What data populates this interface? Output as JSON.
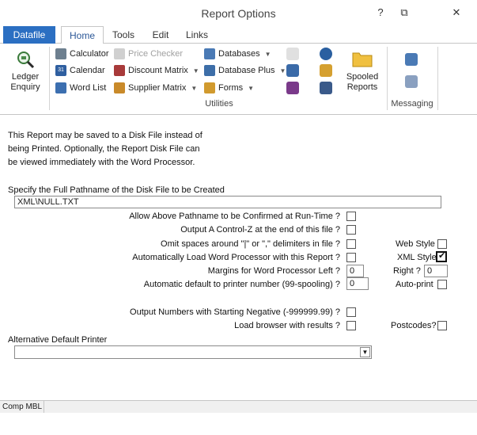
{
  "window": {
    "title": "Report Options"
  },
  "titlebar": {
    "help": "?",
    "restore": "⧉",
    "close": "✕"
  },
  "tabs": {
    "file": "Datafile",
    "home": "Home",
    "tools": "Tools",
    "edit": "Edit",
    "links": "Links"
  },
  "ribbon": {
    "ledger": {
      "line1": "Ledger",
      "line2": "Enquiry"
    },
    "calculator": "Calculator",
    "calendar": "Calendar",
    "wordlist": "Word List",
    "price_checker": "Price Checker",
    "discount_matrix": "Discount Matrix",
    "supplier_matrix": "Supplier Matrix",
    "databases": "Databases",
    "database_plus": "Database Plus",
    "forms": "Forms",
    "spooled": {
      "line1": "Spooled",
      "line2": "Reports"
    },
    "utilities_label": "Utilities",
    "messaging_label": "Messaging"
  },
  "content": {
    "intro_line1": "This Report may be saved to a Disk File instead of",
    "intro_line2": "being Printed. Optionally, the Report Disk File can",
    "intro_line3": "be viewed immediately with the Word Processor.",
    "path_label": "Specify the Full Pathname of the Disk File to be Created",
    "path_value": "XML\\NULL.TXT",
    "opt_confirm": "Allow Above Pathname to be Confirmed at Run-Time ?",
    "opt_ctrlz": "Output A Control-Z at the end of this file ?",
    "opt_omit": "Omit spaces around \"|\" or \",\" delimiters in file ?",
    "opt_autoload": "Automatically Load Word Processor with this Report ?",
    "margin_label": "Margins for Word Processor Left ?",
    "margin_left": "0",
    "right_label": "Right ?",
    "margin_right": "0",
    "printer_label": "Automatic default to printer number (99-spooling) ?",
    "printer_value": "0",
    "web_style": "Web Style",
    "xml_style": "XML Style",
    "auto_print": "Auto-print",
    "opt_negative": "Output Numbers with Starting Negative (-999999.99) ?",
    "opt_browser": "Load browser with results ?",
    "postcodes": "Postcodes?",
    "alt_printer_label": "Alternative Default Printer",
    "alt_printer_value": ""
  },
  "checkboxes": {
    "confirm": false,
    "ctrlz": false,
    "omit": false,
    "autoload": false,
    "web_style": false,
    "xml_style": true,
    "auto_print": false,
    "negative": false,
    "browser": false,
    "postcodes": false
  },
  "status": {
    "company": "Comp MBL"
  },
  "icons": {
    "ledger": "magnifier-ledger-icon",
    "calculator": "calculator-icon",
    "calendar": "calendar-icon",
    "wordlist": "word-list-icon",
    "price_checker": "price-checker-icon",
    "discount": "discount-matrix-icon",
    "supplier": "supplier-matrix-icon",
    "databases": "databases-icon",
    "database_plus": "database-plus-icon",
    "forms": "forms-icon",
    "spooled": "folder-icon"
  },
  "colors": {
    "file_tab": "#2b6fc2",
    "active_tab_text": "#2b5797"
  }
}
